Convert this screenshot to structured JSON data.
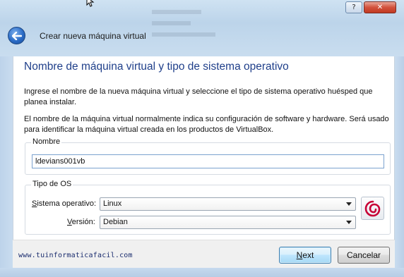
{
  "window": {
    "help_label": "?",
    "close_label": "✕",
    "header_title": "Crear nueva máquina virtual"
  },
  "page": {
    "title": "Nombre de máquina virtual y tipo de sistema operativo",
    "description_1": "Ingrese el nombre de la nueva máquina virtual y seleccione el tipo de sistema operativo huésped que planea instalar.",
    "description_2": "El nombre de la máquina virtual normalmente indica su configuración de software y hardware. Será usado para identificar la máquina virtual creada en los productos de VirtualBox."
  },
  "name_group": {
    "label": "Nombre",
    "value": "ldevians001vb"
  },
  "os_group": {
    "label": "Tipo de OS",
    "os_label_first": "S",
    "os_label_rest": "istema operativo:",
    "os_value": "Linux",
    "version_label_first": "V",
    "version_label_rest": "ersión:",
    "version_value": "Debian",
    "os_icon": "debian-swirl-icon"
  },
  "footer": {
    "link_text": "www.tuinformaticafacil.com",
    "next_first": "N",
    "next_rest": "ext",
    "cancel_label": "Cancelar"
  },
  "colors": {
    "title_blue": "#1f3f8a",
    "debian_red": "#c70036"
  }
}
